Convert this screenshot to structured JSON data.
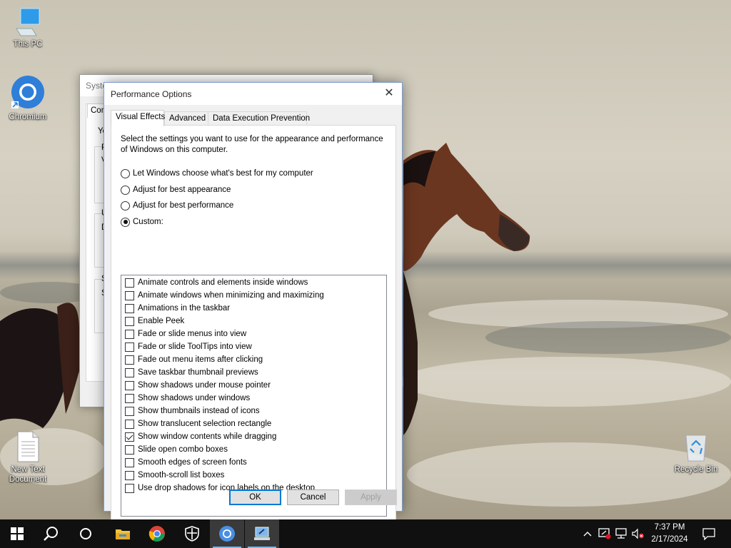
{
  "desktop": {
    "icons": [
      {
        "label": "This PC"
      },
      {
        "label": "Chromium"
      },
      {
        "label": "New Text Document"
      },
      {
        "label": "Recycle Bin"
      }
    ]
  },
  "system_properties": {
    "title": "System Properties",
    "title_visible": "Syste",
    "tab_visible": "Com",
    "text_fragments": [
      "Yo",
      "P",
      "V",
      "U",
      "D",
      "S",
      "S"
    ]
  },
  "performance_options": {
    "title": "Performance Options",
    "tabs": [
      {
        "label": "Visual Effects",
        "active": true
      },
      {
        "label": "Advanced",
        "active": false
      },
      {
        "label": "Data Execution Prevention",
        "active": false
      }
    ],
    "description": "Select the settings you want to use for the appearance and performance of Windows on this computer.",
    "radios": [
      {
        "label": "Let Windows choose what's best for my computer",
        "selected": false
      },
      {
        "label": "Adjust for best appearance",
        "selected": false
      },
      {
        "label": "Adjust for best performance",
        "selected": false
      },
      {
        "label": "Custom:",
        "selected": true
      }
    ],
    "options": [
      {
        "label": "Animate controls and elements inside windows",
        "checked": false
      },
      {
        "label": "Animate windows when minimizing and maximizing",
        "checked": false
      },
      {
        "label": "Animations in the taskbar",
        "checked": false
      },
      {
        "label": "Enable Peek",
        "checked": false
      },
      {
        "label": "Fade or slide menus into view",
        "checked": false
      },
      {
        "label": "Fade or slide ToolTips into view",
        "checked": false
      },
      {
        "label": "Fade out menu items after clicking",
        "checked": false
      },
      {
        "label": "Save taskbar thumbnail previews",
        "checked": false
      },
      {
        "label": "Show shadows under mouse pointer",
        "checked": false
      },
      {
        "label": "Show shadows under windows",
        "checked": false
      },
      {
        "label": "Show thumbnails instead of icons",
        "checked": false
      },
      {
        "label": "Show translucent selection rectangle",
        "checked": false
      },
      {
        "label": "Show window contents while dragging",
        "checked": true
      },
      {
        "label": "Slide open combo boxes",
        "checked": false
      },
      {
        "label": "Smooth edges of screen fonts",
        "checked": false
      },
      {
        "label": "Smooth-scroll list boxes",
        "checked": false
      },
      {
        "label": "Use drop shadows for icon labels on the desktop",
        "checked": false
      }
    ],
    "buttons": {
      "ok": "OK",
      "cancel": "Cancel",
      "apply": "Apply"
    }
  },
  "taskbar": {
    "time": "7:37 PM",
    "date": "2/17/2024",
    "apps": [
      "start-icon",
      "search-icon",
      "cortana-icon",
      "file-explorer-icon",
      "chrome-icon",
      "security-icon",
      "chromium-icon",
      "system-properties-icon"
    ]
  },
  "colors": {
    "accent": "#0078d7",
    "taskbar": "#101010",
    "dialog": "#f0f0f0"
  }
}
